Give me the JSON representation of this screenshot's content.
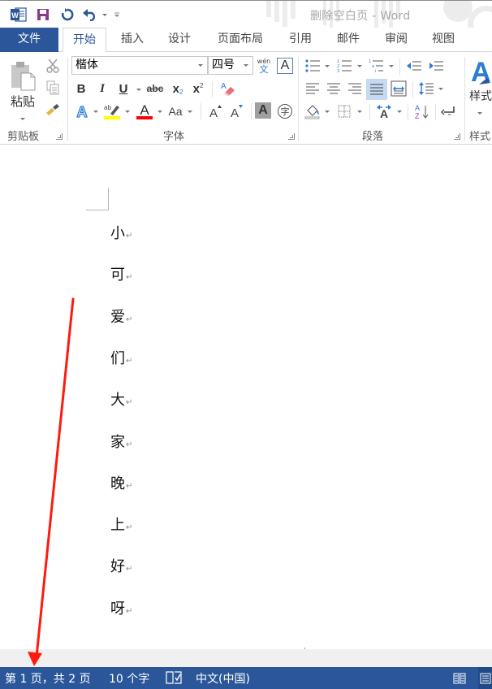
{
  "window": {
    "title": "删除空白页 - Word",
    "app_icon": "word-icon"
  },
  "quick_access": [
    {
      "name": "save",
      "icon": "save-icon"
    },
    {
      "name": "redo",
      "icon": "repeat-icon"
    },
    {
      "name": "undo",
      "icon": "undo-icon"
    },
    {
      "name": "customize",
      "icon": "customize-qat-icon"
    }
  ],
  "tabs": [
    {
      "label": "文件",
      "state": "file"
    },
    {
      "label": "开始",
      "state": "active"
    },
    {
      "label": "插入"
    },
    {
      "label": "设计"
    },
    {
      "label": "页面布局"
    },
    {
      "label": "引用"
    },
    {
      "label": "邮件"
    },
    {
      "label": "审阅"
    },
    {
      "label": "视图"
    }
  ],
  "ribbon": {
    "clipboard": {
      "label": "剪贴板",
      "paste_label": "粘贴"
    },
    "font": {
      "label": "字体",
      "font_name": "楷体",
      "font_size": "四号",
      "phonetic_top": "wén",
      "phonetic_bottom": "文",
      "bold": "B",
      "italic": "I",
      "underline": "U",
      "strikethrough": "abc",
      "subscript_base": "x",
      "subscript_mark": "2",
      "superscript_base": "x",
      "superscript_mark": "2",
      "change_case": "Aa",
      "enclose_char": "字",
      "highlight_color": "#ffff00",
      "font_color": "#ff0000"
    },
    "paragraph": {
      "label": "段落"
    },
    "styles": {
      "label": "样式",
      "button_label": "样式"
    }
  },
  "document": {
    "lines": [
      "小",
      "可",
      "爱",
      "们",
      "大",
      "家",
      "晚",
      "上",
      "好",
      "呀"
    ],
    "paragraph_mark": "↵"
  },
  "statusbar": {
    "page_info": "第 1 页，共 2 页",
    "word_count": "10 个字",
    "language": "中文(中国)"
  },
  "annotation": {
    "color": "#ff1a0f"
  }
}
